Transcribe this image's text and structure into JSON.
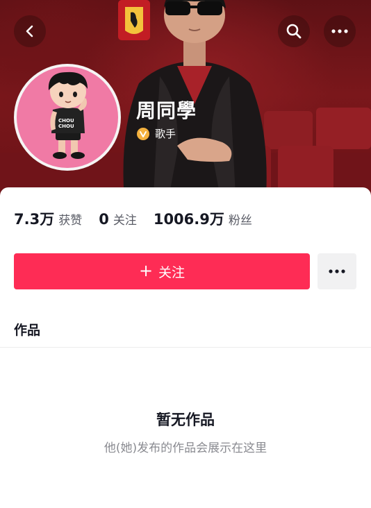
{
  "profile": {
    "name": "周同學",
    "verified_label": "歌手"
  },
  "stats": [
    {
      "value": "7.3万",
      "label": "获赞"
    },
    {
      "value": "0",
      "label": "关注"
    },
    {
      "value": "1006.9万",
      "label": "粉丝"
    }
  ],
  "actions": {
    "follow_plus": "+",
    "follow_label": "关注"
  },
  "tabs": {
    "works": "作品"
  },
  "empty_state": {
    "title": "暂无作品",
    "subtitle": "他(她)发布的作品会展示在这里"
  },
  "icons": {
    "back": "chevron-left-icon",
    "search": "search-icon",
    "more": "more-dots-icon",
    "verified": "verified-v-icon"
  },
  "colors": {
    "accent": "#fe2c55",
    "banner": "#7a171b",
    "verified_badge": "#f4b13e",
    "avatar_bg": "#f07aa5"
  }
}
